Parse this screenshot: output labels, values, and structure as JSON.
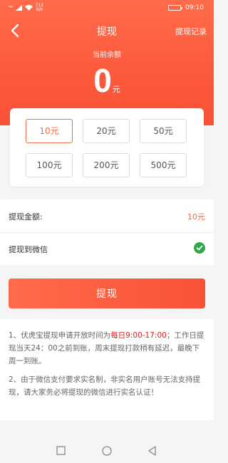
{
  "status": {
    "signal": "⁴⁶",
    "net_speed": "712",
    "net_unit": "B/s",
    "time": "09:10"
  },
  "nav": {
    "title": "提现",
    "right_link": "提现记录"
  },
  "balance": {
    "label": "当前余额",
    "value": "0",
    "unit": "元"
  },
  "options": [
    "10元",
    "20元",
    "50元",
    "100元",
    "200元",
    "500元"
  ],
  "selected_option": "10元",
  "amount_row": {
    "label": "提现金额:",
    "value": "10元"
  },
  "wechat_row": {
    "label": "提现到微信"
  },
  "submit_label": "提现",
  "notes": {
    "n1_pre": "1、伏虎宝提现申请开放时间为",
    "n1_hl": "每日9:00-17:00",
    "n1_post": "；工作日提现当天24：00之前到账，周末提现打款稍有延迟，最晚下周一到账。",
    "n2": "2、由于微信支付要求实名制，非实名用户账号无法支持提现，请大家务必将提现的微信进行实名认证！"
  },
  "colors": {
    "accent": "#f06c46",
    "header": "#fc5a3c",
    "success": "#2ea84a",
    "highlight": "#e02020"
  }
}
